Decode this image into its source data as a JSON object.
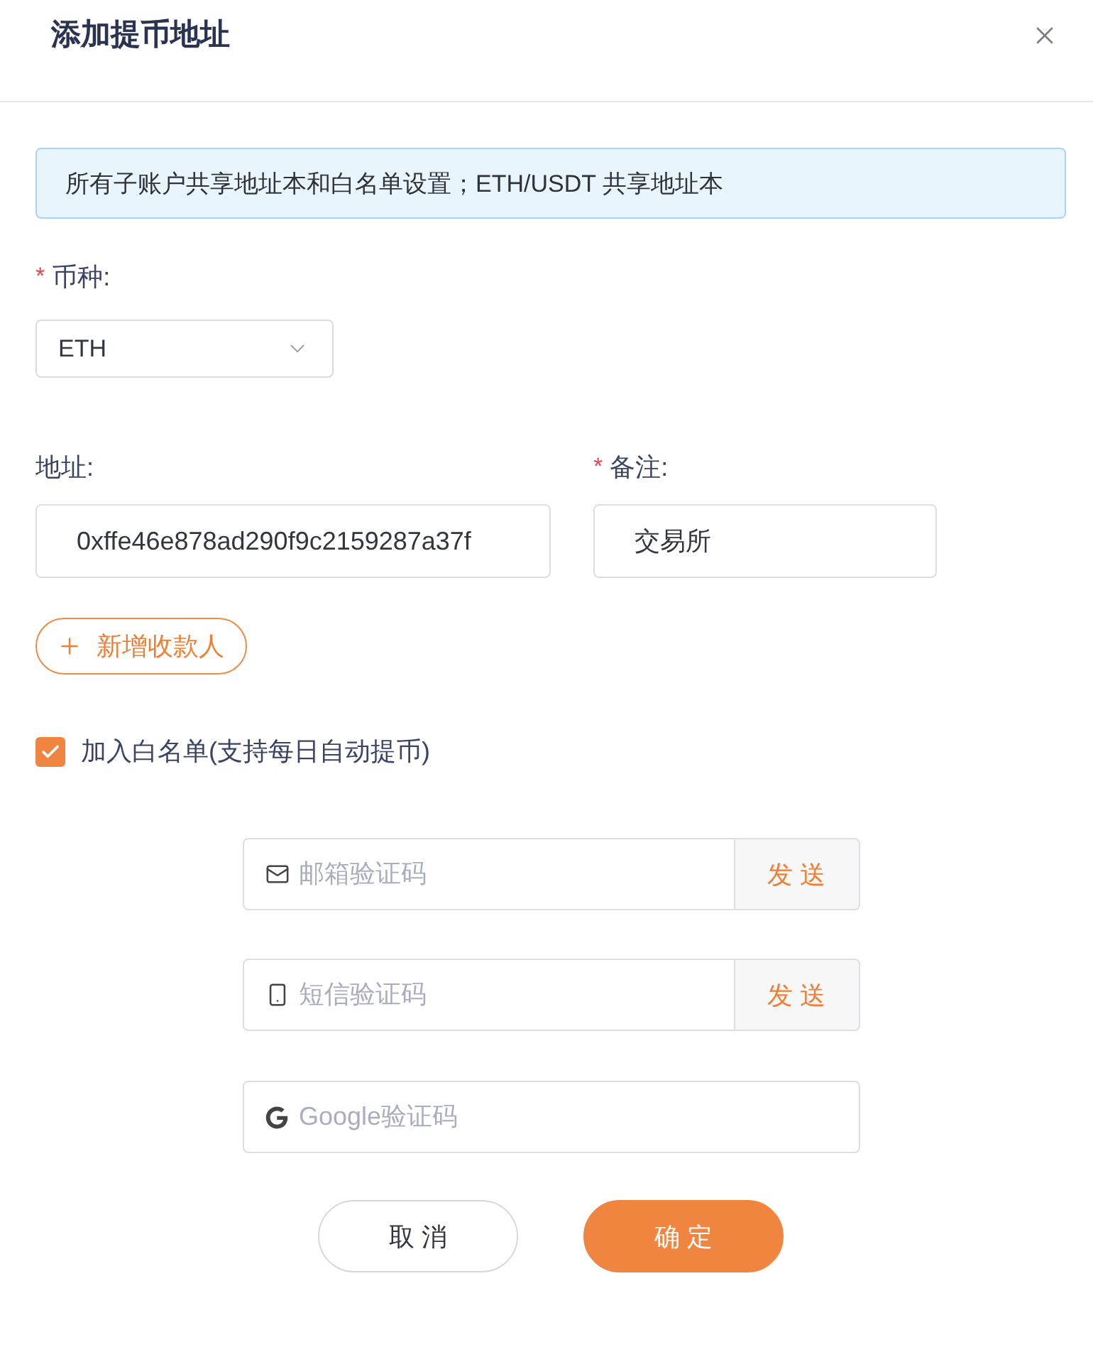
{
  "dialog": {
    "title": "添加提币地址"
  },
  "notice": "所有子账户共享地址本和白名单设置；ETH/USDT 共享地址本",
  "currency": {
    "label": "币种:",
    "required_mark": "*",
    "value": "ETH"
  },
  "address": {
    "label": "地址:",
    "value": "0xffe46e878ad290f9c2159287a37f"
  },
  "remark": {
    "label": "备注:",
    "required_mark": "*",
    "value": "交易所"
  },
  "add_payee": {
    "label": "新增收款人"
  },
  "whitelist": {
    "label": "加入白名单(支持每日自动提币)",
    "checked": true
  },
  "verification": [
    {
      "kind": "email",
      "placeholder": "邮箱验证码",
      "send": "发 送"
    },
    {
      "kind": "sms",
      "placeholder": "短信验证码",
      "send": "发 送"
    },
    {
      "kind": "google",
      "placeholder": "Google验证码"
    }
  ],
  "buttons": [
    {
      "kind": "secondary",
      "label": "取 消"
    },
    {
      "kind": "primary",
      "label": "确 定"
    }
  ]
}
